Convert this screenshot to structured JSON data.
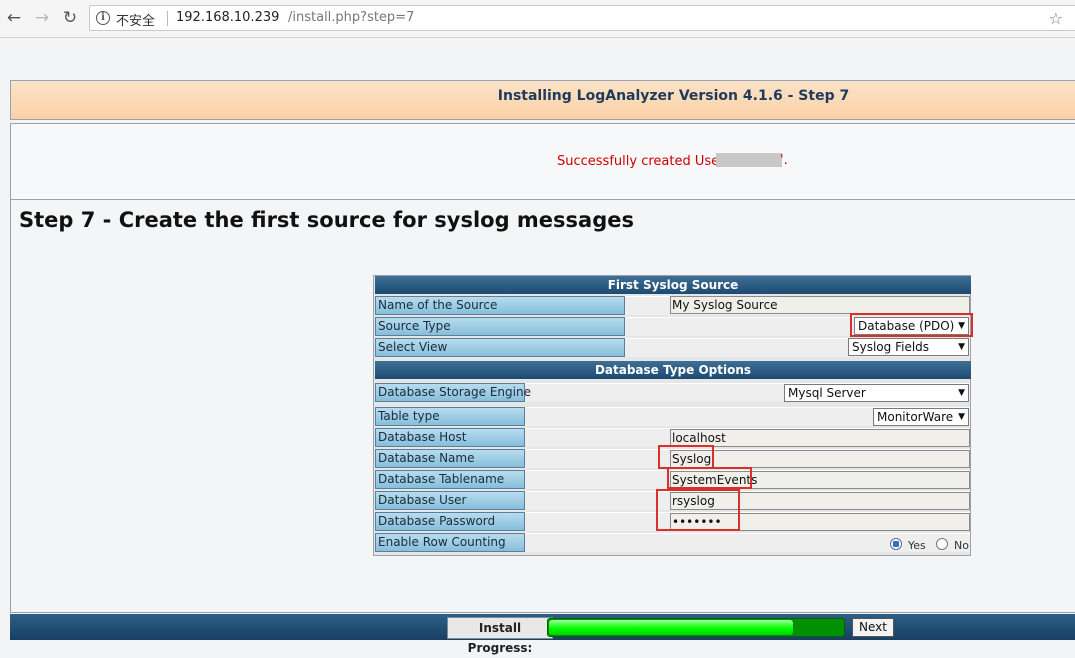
{
  "browser": {
    "security_label": "不安全",
    "url_host": "192.168.10.239",
    "url_path": "/install.php?step=7"
  },
  "page": {
    "title": "Installing LogAnalyzer Version 4.1.6 - Step 7",
    "success_message": "Successfully created User",
    "success_suffix": "'.",
    "step_heading": "Step 7 - Create the first source for syslog messages"
  },
  "form": {
    "section1_header": "First Syslog Source",
    "section2_header": "Database Type Options",
    "name_of_source": {
      "label": "Name of the Source",
      "value": "My Syslog Source"
    },
    "source_type": {
      "label": "Source Type",
      "value": "Database (PDO)"
    },
    "select_view": {
      "label": "Select View",
      "value": "Syslog Fields"
    },
    "storage_engine": {
      "label": "Database Storage Engine",
      "value": "Mysql Server"
    },
    "table_type": {
      "label": "Table type",
      "value": "MonitorWare"
    },
    "db_host": {
      "label": "Database Host",
      "value": "localhost"
    },
    "db_name": {
      "label": "Database Name",
      "value": "Syslog"
    },
    "db_tablename": {
      "label": "Database Tablename",
      "value": "SystemEvents"
    },
    "db_user": {
      "label": "Database User",
      "value": "rsyslog"
    },
    "db_password": {
      "label": "Database Password",
      "value": "•••••••"
    },
    "row_counting": {
      "label": "Enable Row Counting",
      "yes": "Yes",
      "no": "No",
      "selected": "Yes"
    }
  },
  "footer": {
    "progress_label": "Install Progress:",
    "progress": 0.83,
    "next_label": "Next"
  },
  "colors": {
    "highlight": "#d9302c",
    "success_text": "#cc0000",
    "progress_green": "#00ff00"
  }
}
